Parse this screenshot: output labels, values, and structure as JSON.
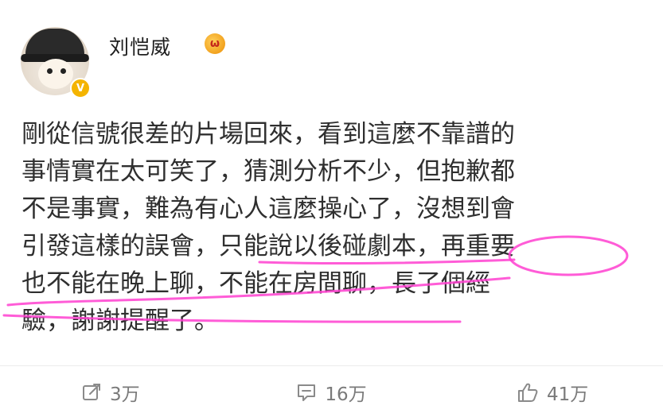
{
  "post": {
    "username": "刘恺威",
    "vip_badge_glyph": "ω",
    "verified_glyph": "V",
    "content_lines": [
      "剛從信號很差的片場回來，看到這麼不靠譜的",
      "事情實在太可笑了，猜測分析不少，但抱歉都",
      "不是事實，難為有心人這麼操心了，沒想到會",
      "引發這樣的誤會，只能說以後碰劇本，再重要",
      "也不能在晚上聊，不能在房間聊，長了個經",
      "驗，謝謝提醒了。"
    ],
    "highlight_color": "#ff3fd0"
  },
  "actions": {
    "repost_count": "3万",
    "comment_count": "16万",
    "like_count": "41万"
  },
  "icons": {
    "repost": "edit-share-icon",
    "comment": "comment-icon",
    "like": "thumbs-up-icon"
  },
  "colors": {
    "text": "#2f2f2f",
    "meta": "#7a7a7a",
    "verified": "#f4b400"
  }
}
